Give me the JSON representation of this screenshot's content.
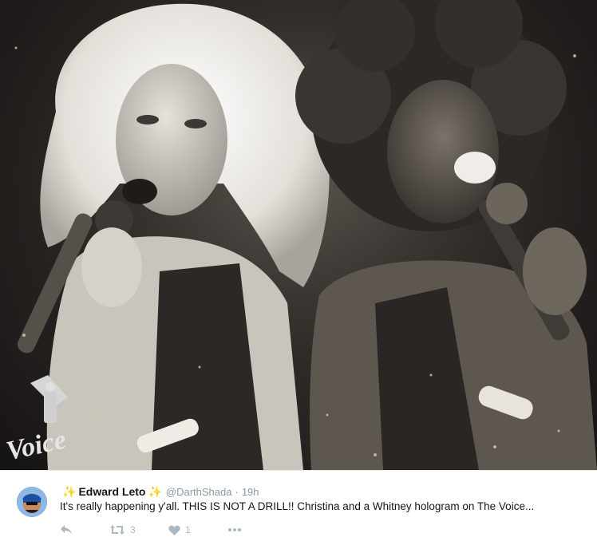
{
  "media": {
    "logo_text": "Voice"
  },
  "tweet": {
    "avatar_icon": "user-avatar-icon",
    "sparkle_left": "✨",
    "author_name": "Edward Leto",
    "sparkle_right": "✨",
    "handle": "@DarthShada",
    "separator": "·",
    "time": "19h",
    "text": "It's really happening y'all. THIS IS NOT A DRILL!! Christina and a Whitney hologram on The Voice...",
    "actions": {
      "reply_icon": "reply-icon",
      "retweet_icon": "retweet-icon",
      "retweet_count": "3",
      "like_icon": "heart-icon",
      "like_count": "1",
      "more_icon": "more-dots-icon"
    }
  },
  "colors": {
    "accent_sparkle": "#9b59d0",
    "muted": "#8899a6",
    "action_grey": "#aab8c2",
    "text": "#14171a"
  }
}
